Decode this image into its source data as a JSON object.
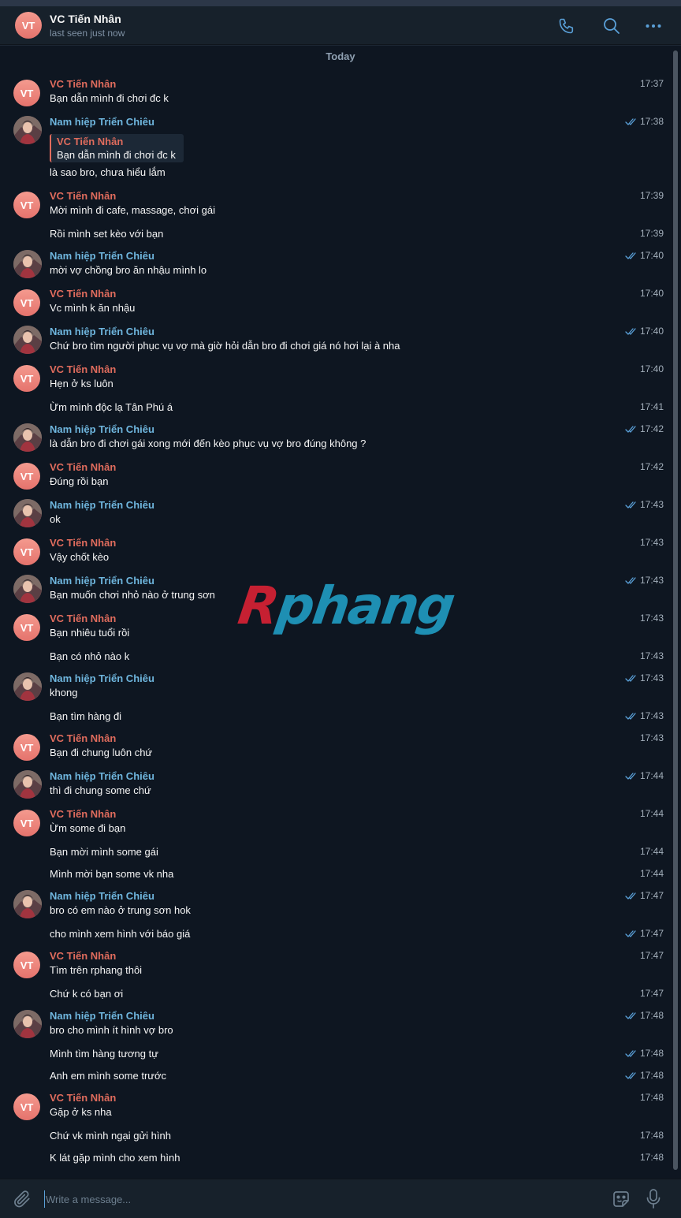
{
  "header": {
    "avatar_initials": "VT",
    "title": "VC Tiến Nhân",
    "status": "last seen just now",
    "icons": [
      "phone-icon",
      "search-icon",
      "more-icon"
    ]
  },
  "colors": {
    "accent": "#5aa0d8",
    "vc_name": "#e06c5d",
    "nh_name": "#6fb6de",
    "chat_bg": "#0e1621"
  },
  "chat": {
    "date_label": "Today",
    "watermark": {
      "part1": "R",
      "part2": "phang"
    },
    "messages": [
      {
        "sender": "VC Tiến Nhân",
        "side": "vc",
        "text": "Bạn dẫn mình đi chơi đc k",
        "time": "17:37"
      },
      {
        "sender": "Nam hiệp Triển Chiêu",
        "side": "nh",
        "reply_name": "VC Tiến Nhân",
        "reply_text": "Bạn dẫn mình đi chơi đc k",
        "text": "là sao bro, chưa hiểu lắm",
        "time": "17:38",
        "read": true
      },
      {
        "sender": "VC Tiến Nhân",
        "side": "vc",
        "text": "Mời mình đi cafe, massage, chơi gái",
        "time": "17:39"
      },
      {
        "sender": "",
        "side": "vc",
        "text": "Rồi mình set kèo với bạn",
        "time": "17:39"
      },
      {
        "sender": "Nam hiệp Triển Chiêu",
        "side": "nh",
        "text": "mời vợ chồng bro ăn nhậu mình lo",
        "time": "17:40",
        "read": true
      },
      {
        "sender": "VC Tiến Nhân",
        "side": "vc",
        "text": "Vc mình k ăn nhậu",
        "time": "17:40"
      },
      {
        "sender": "Nam hiệp Triển Chiêu",
        "side": "nh",
        "text": "Chứ bro tìm người phục vụ vợ mà giờ hỏi dẫn bro đi chơi giá nó hơi lại à nha",
        "time": "17:40",
        "read": true
      },
      {
        "sender": "VC Tiến Nhân",
        "side": "vc",
        "text": "Hẹn ở ks luôn",
        "time": "17:40"
      },
      {
        "sender": "",
        "side": "vc",
        "text": "Ừm mình độc lạ Tân Phú á",
        "time": "17:41"
      },
      {
        "sender": "Nam hiệp Triển Chiêu",
        "side": "nh",
        "text": "là dẫn bro đi chơi gái xong mới đến kèo phục vụ vợ bro đúng không ?",
        "time": "17:42",
        "read": true
      },
      {
        "sender": "VC Tiến Nhân",
        "side": "vc",
        "text": "Đúng rồi bạn",
        "time": "17:42"
      },
      {
        "sender": "Nam hiệp Triển Chiêu",
        "side": "nh",
        "text": "ok",
        "time": "17:43",
        "read": true
      },
      {
        "sender": "VC Tiến Nhân",
        "side": "vc",
        "text": "Vậy chốt kèo",
        "time": "17:43"
      },
      {
        "sender": "Nam hiệp Triển Chiêu",
        "side": "nh",
        "text": "Bạn muốn chơi nhỏ nào ở trung sơn",
        "time": "17:43",
        "read": true
      },
      {
        "sender": "VC Tiến Nhân",
        "side": "vc",
        "text": "Bạn nhiêu tuổi rồi",
        "time": "17:43"
      },
      {
        "sender": "",
        "side": "vc",
        "text": "Bạn có nhỏ nào k",
        "time": "17:43"
      },
      {
        "sender": "Nam hiệp Triển Chiêu",
        "side": "nh",
        "text": "khong",
        "time": "17:43",
        "read": true
      },
      {
        "sender": "",
        "side": "nh",
        "text": "Bạn tìm hàng đi",
        "time": "17:43",
        "read": true
      },
      {
        "sender": "VC Tiến Nhân",
        "side": "vc",
        "text": "Bạn đi chung luôn chứ",
        "time": "17:43"
      },
      {
        "sender": "Nam hiệp Triển Chiêu",
        "side": "nh",
        "text": "thì đi chung some chứ",
        "time": "17:44",
        "read": true
      },
      {
        "sender": "VC Tiến Nhân",
        "side": "vc",
        "text": "Ừm some đi bạn",
        "time": "17:44"
      },
      {
        "sender": "",
        "side": "vc",
        "text": "Bạn mời mình some gái",
        "time": "17:44"
      },
      {
        "sender": "",
        "side": "vc",
        "text": "Mình mời bạn some vk nha",
        "time": "17:44"
      },
      {
        "sender": "Nam hiệp Triển Chiêu",
        "side": "nh",
        "text": "bro có em nào ở trung sơn hok",
        "time": "17:47",
        "read": true
      },
      {
        "sender": "",
        "side": "nh",
        "text": "cho mình xem hình với báo giá",
        "time": "17:47",
        "read": true
      },
      {
        "sender": "VC Tiến Nhân",
        "side": "vc",
        "text": "Tìm trên rphang thôi",
        "time": "17:47"
      },
      {
        "sender": "",
        "side": "vc",
        "text": "Chứ k có bạn ơi",
        "time": "17:47"
      },
      {
        "sender": "Nam hiệp Triển Chiêu",
        "side": "nh",
        "text": "bro cho mình ít hình vợ bro",
        "time": "17:48",
        "read": true
      },
      {
        "sender": "",
        "side": "nh",
        "text": "Mình tìm hàng tương tự",
        "time": "17:48",
        "read": true
      },
      {
        "sender": "",
        "side": "nh",
        "text": "Anh em mình some trước",
        "time": "17:48",
        "read": true
      },
      {
        "sender": "VC Tiến Nhân",
        "side": "vc",
        "text": "Gặp ở ks nha",
        "time": "17:48"
      },
      {
        "sender": "",
        "side": "vc",
        "text": "Chứ vk mình ngại gửi hình",
        "time": "17:48"
      },
      {
        "sender": "",
        "side": "vc",
        "text": "K lát gặp mình cho xem hình",
        "time": "17:48"
      }
    ]
  },
  "composer": {
    "placeholder": "Write a message...",
    "icons": [
      "attach-icon",
      "emoji-icon",
      "microphone-icon"
    ]
  }
}
